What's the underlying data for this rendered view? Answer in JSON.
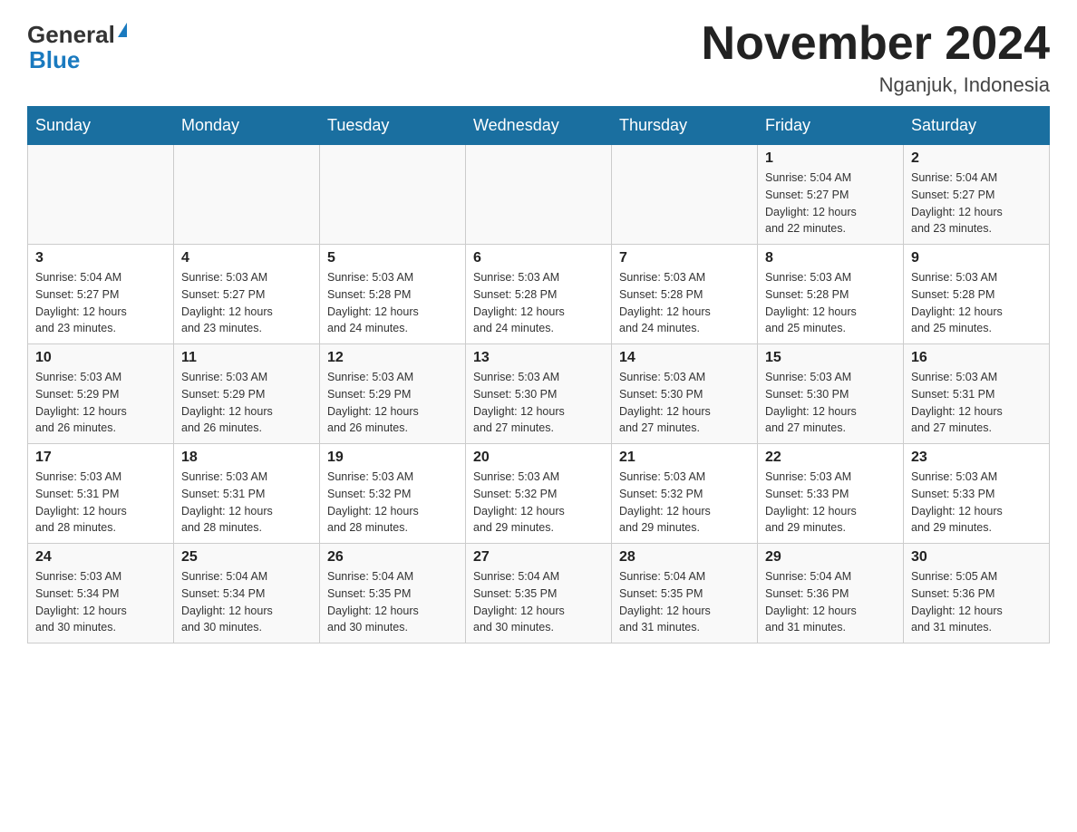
{
  "header": {
    "logo_general": "General",
    "logo_blue": "Blue",
    "month_title": "November 2024",
    "location": "Nganjuk, Indonesia"
  },
  "days_of_week": [
    "Sunday",
    "Monday",
    "Tuesday",
    "Wednesday",
    "Thursday",
    "Friday",
    "Saturday"
  ],
  "weeks": [
    {
      "days": [
        {
          "number": "",
          "info": ""
        },
        {
          "number": "",
          "info": ""
        },
        {
          "number": "",
          "info": ""
        },
        {
          "number": "",
          "info": ""
        },
        {
          "number": "",
          "info": ""
        },
        {
          "number": "1",
          "info": "Sunrise: 5:04 AM\nSunset: 5:27 PM\nDaylight: 12 hours\nand 22 minutes."
        },
        {
          "number": "2",
          "info": "Sunrise: 5:04 AM\nSunset: 5:27 PM\nDaylight: 12 hours\nand 23 minutes."
        }
      ]
    },
    {
      "days": [
        {
          "number": "3",
          "info": "Sunrise: 5:04 AM\nSunset: 5:27 PM\nDaylight: 12 hours\nand 23 minutes."
        },
        {
          "number": "4",
          "info": "Sunrise: 5:03 AM\nSunset: 5:27 PM\nDaylight: 12 hours\nand 23 minutes."
        },
        {
          "number": "5",
          "info": "Sunrise: 5:03 AM\nSunset: 5:28 PM\nDaylight: 12 hours\nand 24 minutes."
        },
        {
          "number": "6",
          "info": "Sunrise: 5:03 AM\nSunset: 5:28 PM\nDaylight: 12 hours\nand 24 minutes."
        },
        {
          "number": "7",
          "info": "Sunrise: 5:03 AM\nSunset: 5:28 PM\nDaylight: 12 hours\nand 24 minutes."
        },
        {
          "number": "8",
          "info": "Sunrise: 5:03 AM\nSunset: 5:28 PM\nDaylight: 12 hours\nand 25 minutes."
        },
        {
          "number": "9",
          "info": "Sunrise: 5:03 AM\nSunset: 5:28 PM\nDaylight: 12 hours\nand 25 minutes."
        }
      ]
    },
    {
      "days": [
        {
          "number": "10",
          "info": "Sunrise: 5:03 AM\nSunset: 5:29 PM\nDaylight: 12 hours\nand 26 minutes."
        },
        {
          "number": "11",
          "info": "Sunrise: 5:03 AM\nSunset: 5:29 PM\nDaylight: 12 hours\nand 26 minutes."
        },
        {
          "number": "12",
          "info": "Sunrise: 5:03 AM\nSunset: 5:29 PM\nDaylight: 12 hours\nand 26 minutes."
        },
        {
          "number": "13",
          "info": "Sunrise: 5:03 AM\nSunset: 5:30 PM\nDaylight: 12 hours\nand 27 minutes."
        },
        {
          "number": "14",
          "info": "Sunrise: 5:03 AM\nSunset: 5:30 PM\nDaylight: 12 hours\nand 27 minutes."
        },
        {
          "number": "15",
          "info": "Sunrise: 5:03 AM\nSunset: 5:30 PM\nDaylight: 12 hours\nand 27 minutes."
        },
        {
          "number": "16",
          "info": "Sunrise: 5:03 AM\nSunset: 5:31 PM\nDaylight: 12 hours\nand 27 minutes."
        }
      ]
    },
    {
      "days": [
        {
          "number": "17",
          "info": "Sunrise: 5:03 AM\nSunset: 5:31 PM\nDaylight: 12 hours\nand 28 minutes."
        },
        {
          "number": "18",
          "info": "Sunrise: 5:03 AM\nSunset: 5:31 PM\nDaylight: 12 hours\nand 28 minutes."
        },
        {
          "number": "19",
          "info": "Sunrise: 5:03 AM\nSunset: 5:32 PM\nDaylight: 12 hours\nand 28 minutes."
        },
        {
          "number": "20",
          "info": "Sunrise: 5:03 AM\nSunset: 5:32 PM\nDaylight: 12 hours\nand 29 minutes."
        },
        {
          "number": "21",
          "info": "Sunrise: 5:03 AM\nSunset: 5:32 PM\nDaylight: 12 hours\nand 29 minutes."
        },
        {
          "number": "22",
          "info": "Sunrise: 5:03 AM\nSunset: 5:33 PM\nDaylight: 12 hours\nand 29 minutes."
        },
        {
          "number": "23",
          "info": "Sunrise: 5:03 AM\nSunset: 5:33 PM\nDaylight: 12 hours\nand 29 minutes."
        }
      ]
    },
    {
      "days": [
        {
          "number": "24",
          "info": "Sunrise: 5:03 AM\nSunset: 5:34 PM\nDaylight: 12 hours\nand 30 minutes."
        },
        {
          "number": "25",
          "info": "Sunrise: 5:04 AM\nSunset: 5:34 PM\nDaylight: 12 hours\nand 30 minutes."
        },
        {
          "number": "26",
          "info": "Sunrise: 5:04 AM\nSunset: 5:35 PM\nDaylight: 12 hours\nand 30 minutes."
        },
        {
          "number": "27",
          "info": "Sunrise: 5:04 AM\nSunset: 5:35 PM\nDaylight: 12 hours\nand 30 minutes."
        },
        {
          "number": "28",
          "info": "Sunrise: 5:04 AM\nSunset: 5:35 PM\nDaylight: 12 hours\nand 31 minutes."
        },
        {
          "number": "29",
          "info": "Sunrise: 5:04 AM\nSunset: 5:36 PM\nDaylight: 12 hours\nand 31 minutes."
        },
        {
          "number": "30",
          "info": "Sunrise: 5:05 AM\nSunset: 5:36 PM\nDaylight: 12 hours\nand 31 minutes."
        }
      ]
    }
  ]
}
